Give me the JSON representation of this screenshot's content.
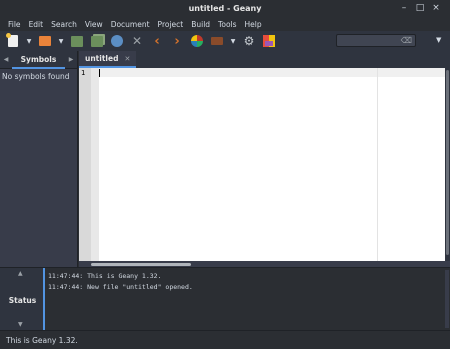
{
  "window": {
    "title": "untitled - Geany",
    "minimize": "–",
    "maximize": "□",
    "close": "×"
  },
  "menu": [
    "File",
    "Edit",
    "Search",
    "View",
    "Document",
    "Project",
    "Build",
    "Tools",
    "Help"
  ],
  "toolbar": {
    "icons": [
      "new-file-icon",
      "open-file-icon",
      "save-icon",
      "save-all-icon",
      "revert-icon",
      "close-file-icon",
      "navigate-back-icon",
      "navigate-forward-icon",
      "compile-icon",
      "build-icon",
      "execute-icon",
      "color-chooser-icon"
    ],
    "search_value": "",
    "search_clear": "⌫"
  },
  "sidebar": {
    "tab_label": "Symbols",
    "prev_arrow": "◀",
    "next_arrow": "▶",
    "message": "No symbols found"
  },
  "editor": {
    "tab_name": "untitled",
    "tab_close": "✕",
    "line_numbers": [
      "1"
    ],
    "content": ""
  },
  "messages": {
    "panel_label": "Status",
    "up_arrow": "▲",
    "down_arrow": "▼",
    "lines": [
      "11:47:44: This is Geany 1.32.",
      "11:47:44: New file \"untitled\" opened."
    ]
  },
  "statusbar": {
    "text": "This is Geany 1.32."
  },
  "colors": {
    "accent": "#5294e2",
    "background": "#2b2e33",
    "panel": "#383c4a"
  }
}
